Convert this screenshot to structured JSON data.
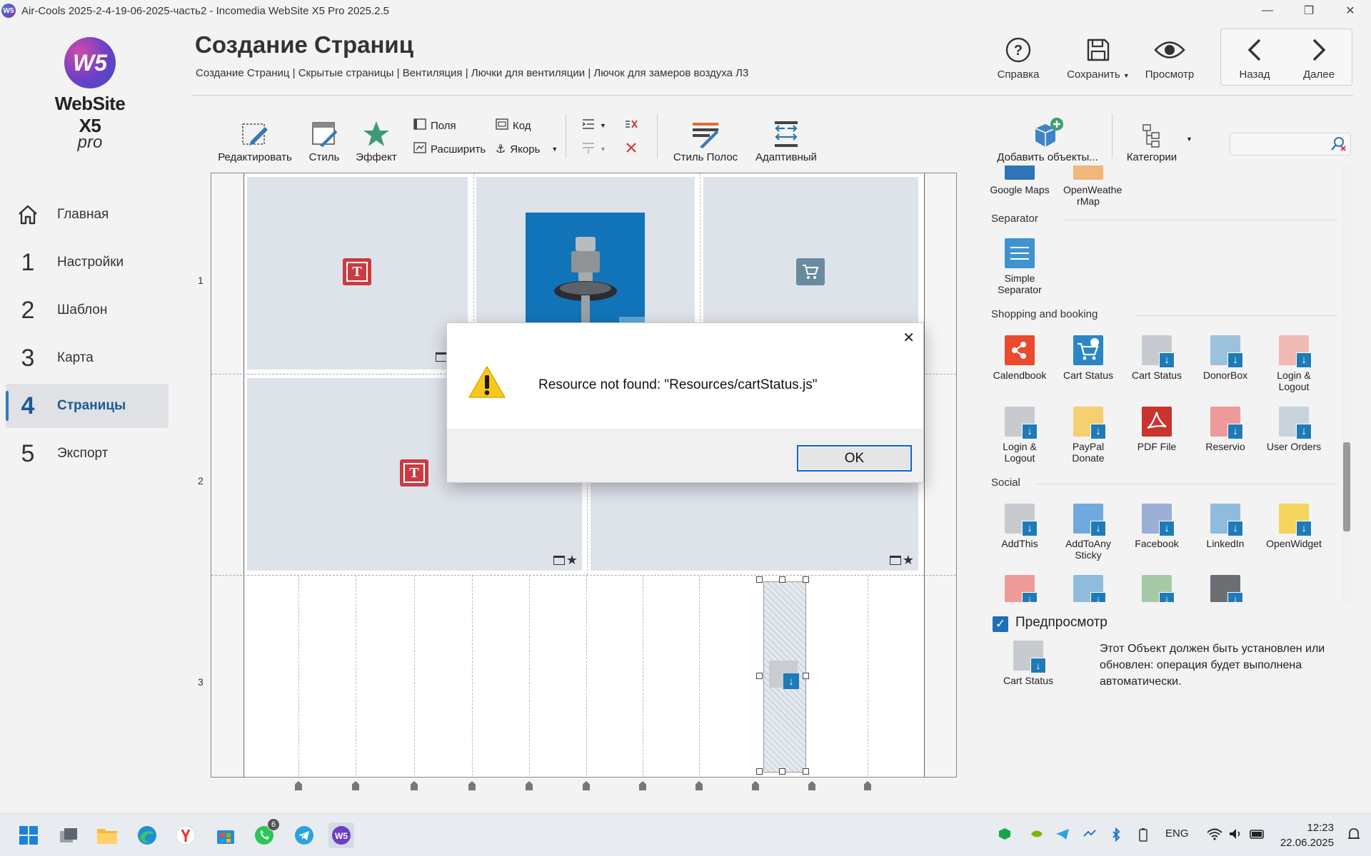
{
  "window": {
    "title": "Air-Cools 2025-2-4-19-06-2025-часть2 - Incomedia WebSite X5 Pro 2025.2.5",
    "minimize": "—",
    "maximize": "❐",
    "close": "✕"
  },
  "logo": {
    "mark": "W5",
    "name": "WebSite X5",
    "edition": "pro"
  },
  "nav": [
    {
      "num": "",
      "label": "Главная",
      "icon": "home-icon"
    },
    {
      "num": "1",
      "label": "Настройки"
    },
    {
      "num": "2",
      "label": "Шаблон"
    },
    {
      "num": "3",
      "label": "Карта"
    },
    {
      "num": "4",
      "label": "Страницы",
      "active": true
    },
    {
      "num": "5",
      "label": "Экспорт"
    }
  ],
  "header": {
    "title": "Создание Страниц",
    "breadcrumb": "Создание Страниц | Скрытые страницы | Вентиляция | Лючки для вентиляции | Лючок для замеров воздуха Л3",
    "help": "Справка",
    "save": "Сохранить",
    "preview": "Просмотр",
    "back": "Назад",
    "next": "Далее"
  },
  "toolbar": {
    "edit": "Редактировать",
    "style": "Стиль",
    "effect": "Эффект",
    "fields": "Поля",
    "expand": "Расширить",
    "code": "Код",
    "anchor": "Якорь",
    "strip_style": "Стиль Полос",
    "adaptive": "Адаптивный",
    "add_objects": "Добавить объекты...",
    "categories": "Категории"
  },
  "grid": {
    "rows": [
      "1",
      "2",
      "3"
    ]
  },
  "panel": {
    "top_items": [
      "Google Maps",
      "OpenWeathe rMap"
    ],
    "sections": {
      "separator": "Separator",
      "shopping": "Shopping and booking",
      "social": "Social"
    },
    "separator_items": [
      "Simple Separator"
    ],
    "shopping_items": [
      "Calendbook",
      "Cart Status",
      "Cart Status",
      "DonorBox",
      "Login & Logout",
      "Login & Logout",
      "PayPal Donate",
      "PDF File",
      "Reservio",
      "User Orders"
    ],
    "social_items": [
      "AddThis",
      "AddToAny Sticky",
      "Facebook",
      "LinkedIn",
      "OpenWidget"
    ],
    "preview_label": "Предпросмотр",
    "preview_object": "Cart Status",
    "preview_description": "Этот Объект должен быть установлен или обновлен: операция будет выполнена автоматически."
  },
  "dialog": {
    "message": "Resource not found: \"Resources/cartStatus.js\"",
    "ok": "OK",
    "close": "✕"
  },
  "taskbar": {
    "whatsapp_badge": "6",
    "lang": "ENG",
    "time": "12:23",
    "date": "22.06.2025"
  },
  "colors": {
    "accent": "#2f7bbf",
    "dialog_ok_border": "#0a64c8",
    "text_object_red": "#cc3b42"
  }
}
